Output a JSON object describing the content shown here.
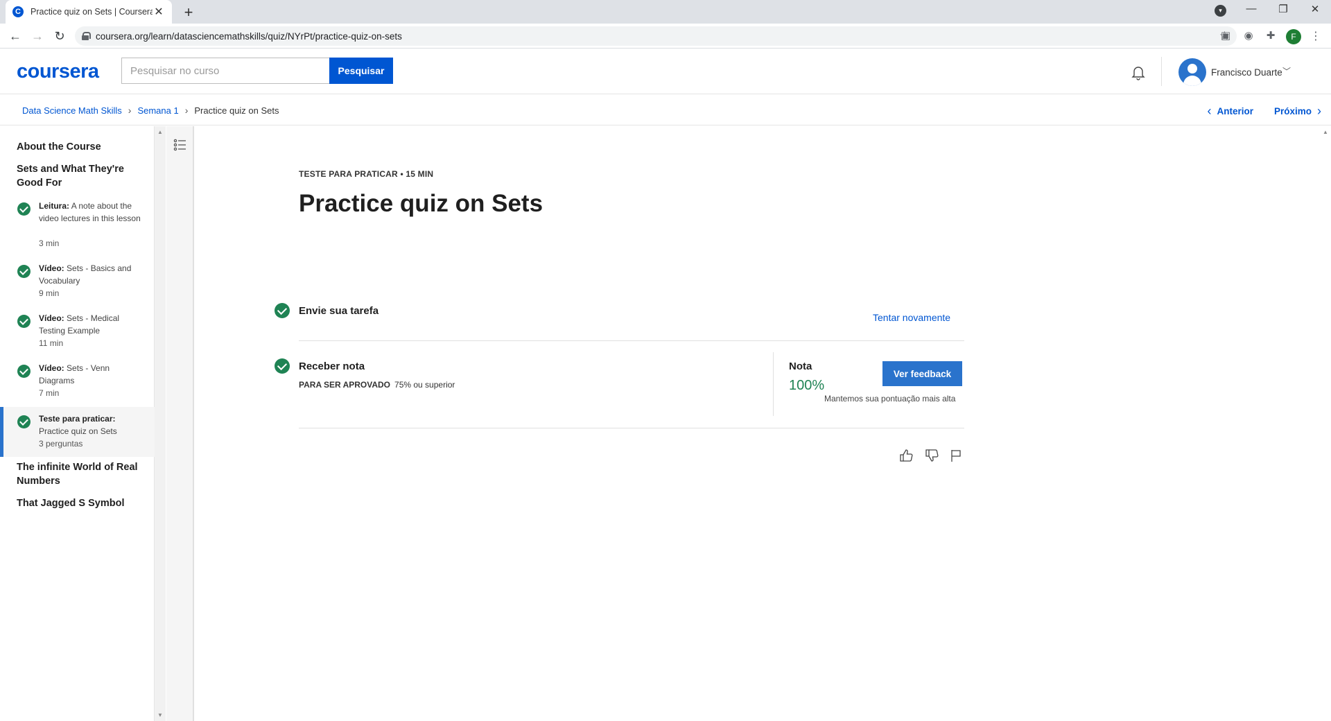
{
  "browser": {
    "tab_title": "Practice quiz on Sets | Coursera",
    "tab_close": "✕",
    "new_tab": "+",
    "url": "coursera.org/learn/datasciencemathskills/quiz/NYrPt/practice-quiz-on-sets",
    "profile_initial": "F",
    "favicon_letter": "C"
  },
  "header": {
    "logo": "coursera",
    "search_placeholder": "Pesquisar no curso",
    "search_button": "Pesquisar",
    "user_name": "Francisco Duarte"
  },
  "breadcrumb": {
    "items": [
      "Data Science Math Skills",
      "Semana 1"
    ],
    "current": "Practice quiz on Sets",
    "prev": "Anterior",
    "next": "Próximo"
  },
  "sidebar": {
    "sections": [
      "About the Course",
      "Sets and What They're Good For",
      "The infinite World of Real Numbers",
      "That Jagged S Symbol"
    ],
    "items": [
      {
        "type": "Leitura:",
        "title": "A note about the video lectures in this lesson",
        "meta": "3 min"
      },
      {
        "type": "Vídeo:",
        "title": "Sets - Basics and Vocabulary",
        "meta": "9 min"
      },
      {
        "type": "Vídeo:",
        "title": "Sets - Medical Testing Example",
        "meta": "11 min"
      },
      {
        "type": "Vídeo:",
        "title": "Sets - Venn Diagrams",
        "meta": "7 min"
      },
      {
        "type": "Teste para praticar:",
        "title": "Practice quiz on Sets",
        "meta": "3 perguntas"
      }
    ]
  },
  "main": {
    "eyebrow": "TESTE PARA PRATICAR • 15 MIN",
    "title": "Practice quiz on Sets",
    "step1": {
      "title": "Envie sua tarefa",
      "action": "Tentar novamente"
    },
    "step2": {
      "title": "Receber nota",
      "pass_label": "PARA SER APROVADO",
      "pass_value": "75% ou superior",
      "grade_label": "Nota",
      "grade_value": "100%",
      "feedback_button": "Ver feedback",
      "grade_note": "Mantemos sua pontuação mais alta"
    }
  },
  "colors": {
    "brand": "#0056d2",
    "success": "#1f8354",
    "button": "#2a73cc"
  }
}
